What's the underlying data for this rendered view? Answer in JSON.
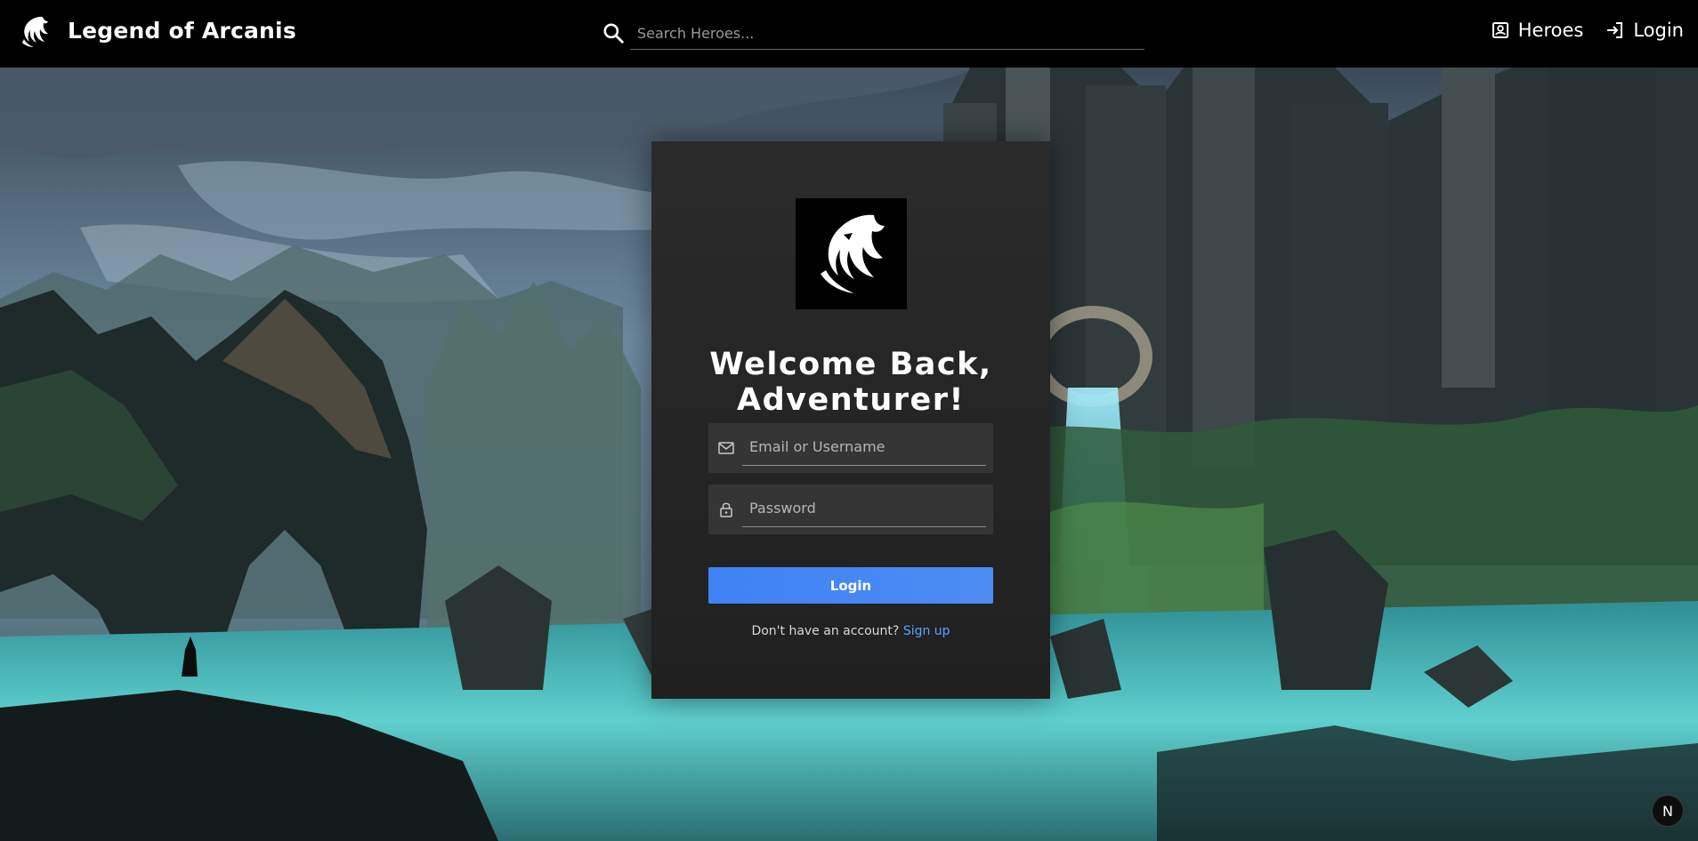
{
  "nav": {
    "brand_title": "Legend of Arcanis",
    "search_placeholder": "Search Heroes...",
    "links": [
      {
        "label": "Heroes",
        "icon": "portrait-icon"
      },
      {
        "label": "Login",
        "icon": "login-arrow-icon"
      }
    ]
  },
  "login_card": {
    "title": "Welcome Back,\nAdventurer!",
    "email_placeholder": "Email or Username",
    "email_icon": "mail-icon",
    "password_placeholder": "Password",
    "password_icon": "lock-icon",
    "submit_label": "Login",
    "signup_prompt": "Don't have an account?",
    "signup_link": "Sign up"
  },
  "corner_badge": {
    "label": "N"
  },
  "colors": {
    "navbar_bg": "#000000",
    "card_bg": "#262626",
    "field_bg": "#353535",
    "button_blue": "#4585f4",
    "link_blue": "#5aa2ff"
  }
}
